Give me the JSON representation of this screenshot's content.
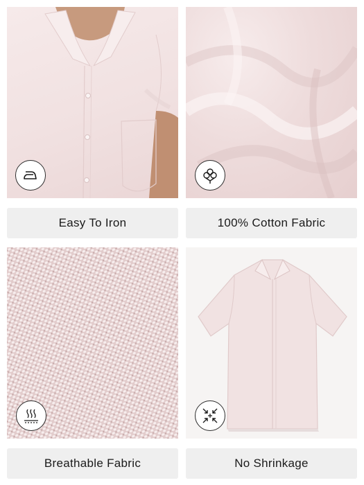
{
  "features": [
    {
      "label": "Easy To Iron",
      "icon": "iron-icon"
    },
    {
      "label": "100% Cotton Fabric",
      "icon": "cotton-flower-icon"
    },
    {
      "label": "Breathable Fabric",
      "icon": "breathable-waves-icon"
    },
    {
      "label": "No Shrinkage",
      "icon": "no-shrink-arrows-icon"
    }
  ],
  "colors": {
    "shirt": "#f1e2e2",
    "caption_bg": "#efefef",
    "text": "#1a1a1a"
  }
}
